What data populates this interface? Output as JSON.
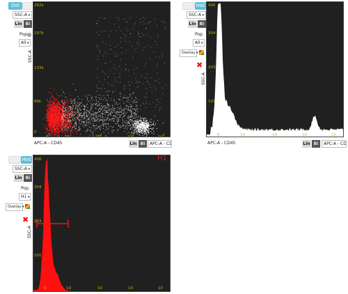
{
  "panel1": {
    "tab_dot": "Dot",
    "tab_hist": "Hist",
    "y_select": "SSC-A",
    "lin": "Lin",
    "bi": "Bi",
    "pop_label": "Pop.",
    "pop_select": "All",
    "y_axis_label": "SSC-A",
    "y_ticks": [
      "262k",
      "197k",
      "133k",
      "66k",
      "0"
    ],
    "x_ticks": [
      "0",
      "10",
      "10",
      "10",
      "10"
    ],
    "x_exponents": [
      "0",
      "1",
      "2",
      "3",
      "4"
    ],
    "x_axis_label": "APC-A - CD45",
    "x_lin": "Lin",
    "x_bi": "Bi",
    "x_select": "APC-A - CD"
  },
  "panel2": {
    "tab_dot": "",
    "tab_hist": "Hist",
    "y_select": "SSC-A",
    "lin": "Lin",
    "bi": "Bi",
    "pop_label": "Pop.",
    "pop_select": "All",
    "overlay_select": "Overlay",
    "y_axis_label": "SSC-A",
    "y_ticks": [
      "406",
      "304",
      "203",
      "101"
    ],
    "x_ticks": [
      "0",
      "10",
      "10",
      "10",
      "10"
    ],
    "x_axis_label": "APC-A - CD45",
    "x_lin": "Lin",
    "x_bi": "Bi",
    "x_select": "APC-A - CD"
  },
  "panel3": {
    "tab_dot": "",
    "tab_hist": "Hist",
    "y_select": "SSC-A",
    "lin": "Lin",
    "bi": "Bi",
    "pop_label": "Pop.",
    "pop_select": "H1",
    "overlay_select": "Overlay",
    "y_axis_label": "SSC-A",
    "y_ticks": [
      "406",
      "304",
      "203",
      "101"
    ],
    "x_ticks": [
      "0",
      "10",
      "10",
      "10",
      "10"
    ],
    "gate_name": "H1"
  },
  "colors": {
    "plot_bg": "#202020",
    "tick": "#c8b400",
    "gate": "#e01818",
    "tab_active": "#5bc0de"
  }
}
